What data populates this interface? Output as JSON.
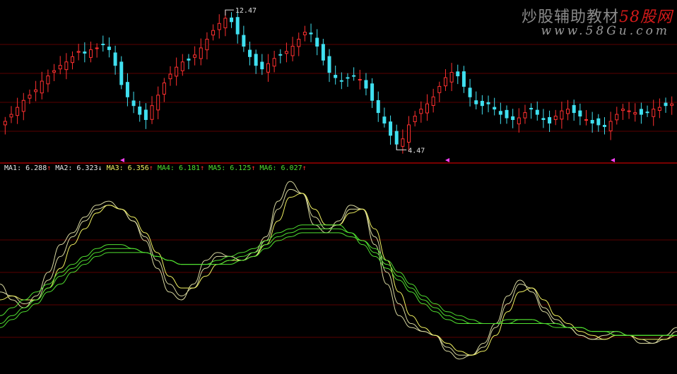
{
  "watermark": {
    "brand_text": "炒股辅助教材",
    "brand_suffix": "58股网",
    "url": "www.58Gu.com"
  },
  "price_panel": {
    "high_label": "12.47",
    "low_label": "4.47"
  },
  "ma_indicators": [
    {
      "label": "MA1",
      "value": "6.288",
      "arrow": "↑",
      "color": "#e8e8e8"
    },
    {
      "label": "MA2",
      "value": "6.323",
      "arrow": "↓",
      "color": "#e8e8e8"
    },
    {
      "label": "MA3",
      "value": "6.356",
      "arrow": "↑",
      "color": "#f0f060"
    },
    {
      "label": "MA4",
      "value": "6.181",
      "arrow": "↑",
      "color": "#50e030"
    },
    {
      "label": "MA5",
      "value": "6.125",
      "arrow": "↑",
      "color": "#50e030"
    },
    {
      "label": "MA6",
      "value": "6.027",
      "arrow": "↑",
      "color": "#50e030"
    }
  ],
  "colors": {
    "background": "#000000",
    "up_candle": "#ff3030",
    "down_candle": "#40e0f0",
    "grid": "#5a0000",
    "divider": "#a00000",
    "marker": "#ff40ff",
    "ma_fast": "#f0f060",
    "ma_mid": "#d8d8a0",
    "ma_slow": "#50e030"
  },
  "chart_data": [
    {
      "type": "candlestick",
      "title": "",
      "ylim": [
        4.0,
        12.8
      ],
      "annotations": [
        "12.47",
        "4.47"
      ],
      "close": [
        6.1,
        6.5,
        6.9,
        7.3,
        7.6,
        7.9,
        8.4,
        8.7,
        9.0,
        9.3,
        9.5,
        9.8,
        10.1,
        10.0,
        10.2,
        10.3,
        10.5,
        10.2,
        9.3,
        8.2,
        7.5,
        7.0,
        6.5,
        6.2,
        7.0,
        7.6,
        8.3,
        8.8,
        9.2,
        9.5,
        9.6,
        9.9,
        10.3,
        10.8,
        11.3,
        11.7,
        12.0,
        11.8,
        11.1,
        10.4,
        9.8,
        9.3,
        9.1,
        9.4,
        9.7,
        9.9,
        10.1,
        10.4,
        10.8,
        11.2,
        11.1,
        10.4,
        9.6,
        8.9,
        8.6,
        8.4,
        8.6,
        8.7,
        8.5,
        8.0,
        7.3,
        6.6,
        6.0,
        5.3,
        4.8,
        5.1,
        5.9,
        6.4,
        6.8,
        7.1,
        7.5,
        8.1,
        8.6,
        8.9,
        8.7,
        8.1,
        7.5,
        7.1,
        7.0,
        7.1,
        6.8,
        6.5,
        6.3,
        6.2,
        6.3,
        6.6,
        6.8,
        6.5,
        6.2,
        6.0,
        6.4,
        6.7,
        6.8,
        6.6,
        6.4,
        6.2,
        6.0,
        5.9,
        5.8,
        6.1,
        6.5,
        6.8,
        6.7,
        6.6,
        6.5,
        6.6,
        6.8,
        6.9,
        7.0,
        7.1
      ],
      "high_value": 12.47,
      "low_value": 4.47
    },
    {
      "type": "line",
      "title": "",
      "series": [
        {
          "name": "MA1",
          "values": [
            6.6,
            6.2,
            6.0,
            6.3,
            6.9,
            7.6,
            7.9,
            8.3,
            8.6,
            8.7,
            8.5,
            8.2,
            7.7,
            7.0,
            6.4,
            6.2,
            6.6,
            7.2,
            7.4,
            7.3,
            7.2,
            7.4,
            7.8,
            8.7,
            9.2,
            8.9,
            8.1,
            7.9,
            8.2,
            8.6,
            8.5,
            7.6,
            6.6,
            5.8,
            5.5,
            5.4,
            5.3,
            4.9,
            4.7,
            4.8,
            5.1,
            5.6,
            6.3,
            6.7,
            6.4,
            5.9,
            5.6,
            5.5,
            5.3,
            5.2,
            5.3,
            5.4,
            5.3,
            5.1,
            5.1,
            5.3,
            5.5
          ]
        },
        {
          "name": "MA2",
          "values": [
            6.4,
            6.3,
            6.1,
            6.2,
            6.7,
            7.3,
            7.8,
            8.2,
            8.5,
            8.6,
            8.5,
            8.2,
            7.8,
            7.2,
            6.6,
            6.3,
            6.5,
            7.0,
            7.3,
            7.3,
            7.2,
            7.3,
            7.7,
            8.5,
            9.0,
            8.9,
            8.3,
            8.0,
            8.1,
            8.5,
            8.5,
            7.8,
            6.9,
            6.1,
            5.6,
            5.4,
            5.3,
            5.0,
            4.8,
            4.8,
            5.0,
            5.5,
            6.1,
            6.6,
            6.5,
            6.0,
            5.7,
            5.5,
            5.3,
            5.2,
            5.2,
            5.3,
            5.3,
            5.2,
            5.1,
            5.2,
            5.4
          ]
        },
        {
          "name": "MA3",
          "values": [
            6.2,
            6.3,
            6.2,
            6.2,
            6.5,
            7.0,
            7.6,
            8.0,
            8.4,
            8.6,
            8.5,
            8.3,
            7.9,
            7.4,
            6.8,
            6.5,
            6.5,
            6.8,
            7.1,
            7.2,
            7.2,
            7.3,
            7.6,
            8.2,
            8.8,
            8.9,
            8.5,
            8.1,
            8.1,
            8.4,
            8.5,
            8.0,
            7.2,
            6.4,
            5.8,
            5.5,
            5.3,
            5.1,
            4.9,
            4.8,
            4.9,
            5.3,
            5.9,
            6.4,
            6.5,
            6.2,
            5.8,
            5.6,
            5.4,
            5.3,
            5.2,
            5.3,
            5.3,
            5.2,
            5.2,
            5.2,
            5.3
          ]
        },
        {
          "name": "MA4",
          "values": [
            5.8,
            6.0,
            6.2,
            6.4,
            6.6,
            6.9,
            7.1,
            7.3,
            7.5,
            7.6,
            7.6,
            7.5,
            7.4,
            7.3,
            7.2,
            7.1,
            7.1,
            7.1,
            7.2,
            7.3,
            7.4,
            7.5,
            7.7,
            7.9,
            8.0,
            8.1,
            8.1,
            8.1,
            8.1,
            7.9,
            7.6,
            7.3,
            7.0,
            6.7,
            6.4,
            6.1,
            5.9,
            5.7,
            5.6,
            5.6,
            5.6,
            5.6,
            5.7,
            5.7,
            5.7,
            5.6,
            5.6,
            5.5,
            5.5,
            5.4,
            5.4,
            5.3,
            5.3,
            5.3,
            5.3,
            5.3,
            5.3
          ]
        },
        {
          "name": "MA5",
          "values": [
            5.6,
            5.8,
            6.0,
            6.2,
            6.5,
            6.8,
            7.0,
            7.2,
            7.4,
            7.5,
            7.5,
            7.5,
            7.4,
            7.3,
            7.2,
            7.1,
            7.1,
            7.1,
            7.1,
            7.2,
            7.3,
            7.4,
            7.6,
            7.8,
            7.9,
            8.0,
            8.0,
            8.0,
            8.0,
            7.9,
            7.7,
            7.4,
            7.1,
            6.8,
            6.5,
            6.2,
            6.0,
            5.8,
            5.7,
            5.6,
            5.6,
            5.6,
            5.6,
            5.7,
            5.7,
            5.6,
            5.6,
            5.5,
            5.5,
            5.4,
            5.4,
            5.3,
            5.3,
            5.3,
            5.3,
            5.3,
            5.3
          ]
        },
        {
          "name": "MA6",
          "values": [
            5.5,
            5.7,
            5.9,
            6.1,
            6.4,
            6.6,
            6.9,
            7.1,
            7.3,
            7.4,
            7.4,
            7.4,
            7.4,
            7.3,
            7.2,
            7.1,
            7.1,
            7.1,
            7.1,
            7.1,
            7.2,
            7.3,
            7.5,
            7.7,
            7.8,
            7.9,
            7.9,
            7.9,
            7.9,
            7.8,
            7.7,
            7.5,
            7.2,
            6.9,
            6.6,
            6.3,
            6.1,
            5.9,
            5.8,
            5.7,
            5.6,
            5.6,
            5.6,
            5.6,
            5.6,
            5.6,
            5.5,
            5.5,
            5.5,
            5.4,
            5.4,
            5.4,
            5.3,
            5.3,
            5.3,
            5.3,
            5.3
          ]
        }
      ]
    }
  ]
}
